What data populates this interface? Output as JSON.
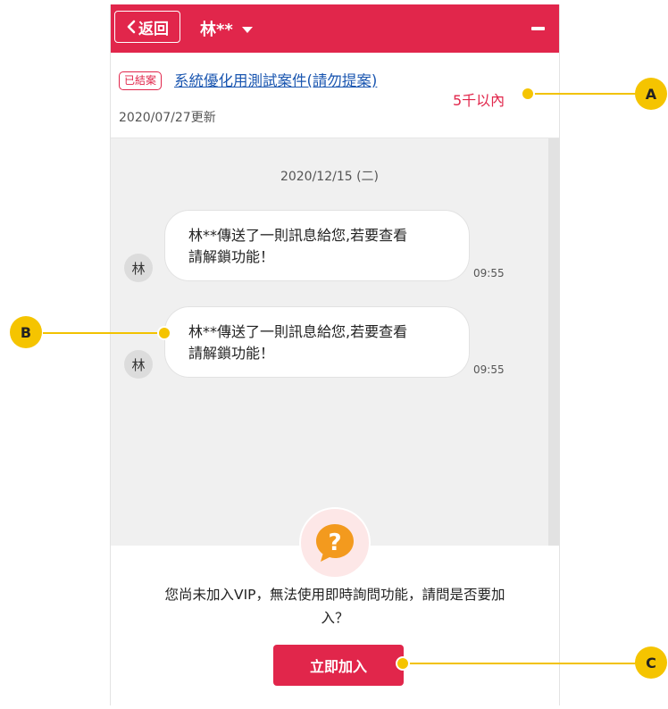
{
  "header": {
    "back_label": "返回",
    "chat_title": "林**",
    "accent_color": "#e1264b"
  },
  "case": {
    "status_badge": "已結案",
    "title": "系統優化用測試案件(請勿提案)",
    "budget": "5千以內",
    "updated": "2020/07/27更新"
  },
  "chat": {
    "date": "2020/12/15 (二)",
    "messages": [
      {
        "avatar": "林",
        "line1": "林**傳送了一則訊息給您,若要查看",
        "line2": "請解鎖功能！",
        "time": "09:55"
      },
      {
        "avatar": "林",
        "line1": "林**傳送了一則訊息給您,若要查看",
        "line2": "請解鎖功能！",
        "time": "09:55"
      }
    ]
  },
  "vip": {
    "icon": "question-bubble-icon",
    "message_line1": "您尚未加入VIP，無法使用即時詢問功能，請問是否要加",
    "message_line2": "入？",
    "join_label": "立即加入"
  },
  "callouts": {
    "a": "A",
    "b": "B",
    "c": "C",
    "color": "#f5c400"
  }
}
